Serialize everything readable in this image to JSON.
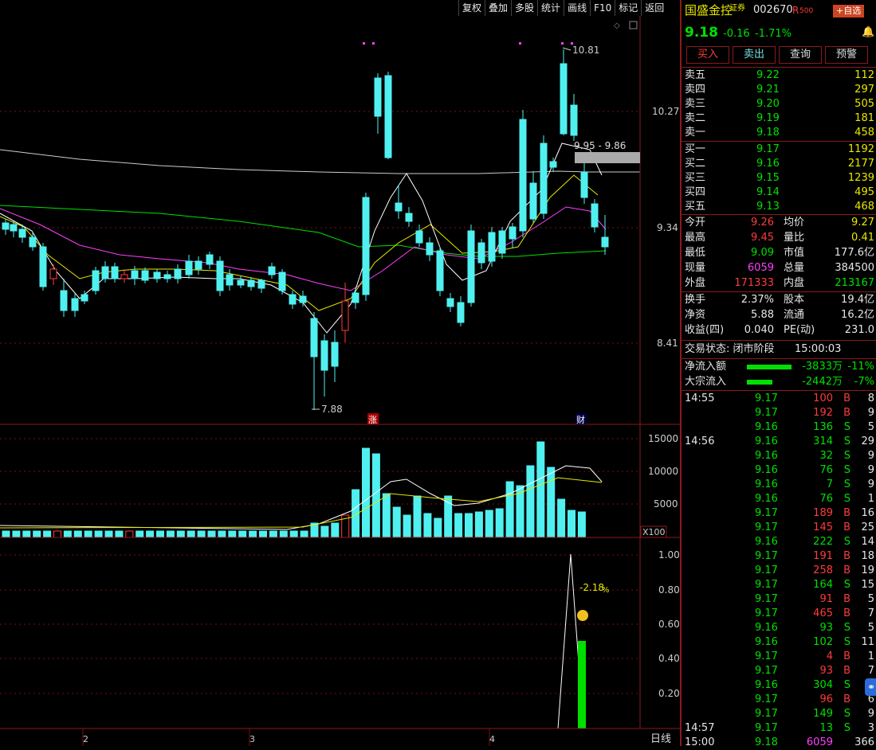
{
  "toolbar": [
    "复权",
    "叠加",
    "多股",
    "统计",
    "画线",
    "F10",
    "标记",
    "返回"
  ],
  "chart": {
    "price_ticks": [
      "10.27",
      "9.34",
      "8.41"
    ],
    "high_label": "10.81",
    "low_label": "7.88",
    "range_label": "9.95 - 9.86",
    "marker_zhang": "涨",
    "marker_cai": "财",
    "vol_ticks": [
      "15000",
      "10000",
      "5000"
    ],
    "vol_unit": "X100",
    "ind_ticks": [
      "1.00",
      "0.80",
      "0.60",
      "0.40",
      "0.20"
    ],
    "ind_label": "-2.18",
    "ind_pct": "%",
    "x_labels": [
      "2",
      "3",
      "4"
    ],
    "period": "日线",
    "colors": {
      "up": "#ff3b3b",
      "down": "#50f0f0",
      "ma5": "#ffffff",
      "ma10": "#e8e800",
      "ma20": "#ff40ff",
      "ma60": "#00e000",
      "ma250": "#cccccc"
    }
  },
  "stock": {
    "name": "国盛金控",
    "badge": "证券",
    "code": "002670",
    "tag": "R",
    "tag_num": "500",
    "add_btn": "+自选",
    "price": "9.18",
    "change": "-0.16",
    "change_pct": "-1.71%",
    "buttons": [
      "买入",
      "卖出",
      "查询",
      "预警"
    ]
  },
  "sell": [
    {
      "label": "卖五",
      "price": "9.22",
      "vol": "112"
    },
    {
      "label": "卖四",
      "price": "9.21",
      "vol": "297"
    },
    {
      "label": "卖三",
      "price": "9.20",
      "vol": "505"
    },
    {
      "label": "卖二",
      "price": "9.19",
      "vol": "181"
    },
    {
      "label": "卖一",
      "price": "9.18",
      "vol": "458"
    }
  ],
  "buy": [
    {
      "label": "买一",
      "price": "9.17",
      "vol": "1192"
    },
    {
      "label": "买二",
      "price": "9.16",
      "vol": "2177"
    },
    {
      "label": "买三",
      "price": "9.15",
      "vol": "1239"
    },
    {
      "label": "买四",
      "price": "9.14",
      "vol": "495"
    },
    {
      "label": "买五",
      "price": "9.13",
      "vol": "468"
    }
  ],
  "stats": [
    {
      "l1": "今开",
      "v1": "9.26",
      "l2": "均价",
      "v2": "9.27"
    },
    {
      "l1": "最高",
      "v1": "9.45",
      "l2": "量比",
      "v2": "0.41"
    },
    {
      "l1": "最低",
      "v1": "9.09",
      "l2": "市值",
      "v2": "177.6亿"
    },
    {
      "l1": "现量",
      "v1": "6059",
      "l2": "总量",
      "v2": "384500"
    },
    {
      "l1": "外盘",
      "v1": "171333",
      "l2": "内盘",
      "v2": "213167"
    }
  ],
  "stats2": [
    {
      "l1": "换手",
      "v1": "2.37%",
      "l2": "股本",
      "v2": "19.4亿"
    },
    {
      "l1": "净资",
      "v1": "5.88",
      "l2": "流通",
      "v2": "16.2亿"
    },
    {
      "l1": "收益(四)",
      "v1": "0.040",
      "l2": "PE(动)",
      "v2": "231.0"
    }
  ],
  "trade_status": "交易状态: 闭市阶段",
  "trade_time": "15:00:03",
  "flows": [
    {
      "label": "净流入额",
      "value": "-3833万",
      "pct": "-11%",
      "bar": 0.7
    },
    {
      "label": "大宗流入",
      "value": "-2442万",
      "pct": "-7%",
      "bar": 0.4
    }
  ],
  "ticks": [
    {
      "time": "14:55",
      "price": "9.17",
      "vol": "100",
      "side": "B",
      "n": "8"
    },
    {
      "time": "",
      "price": "9.17",
      "vol": "192",
      "side": "B",
      "n": "9"
    },
    {
      "time": "",
      "price": "9.16",
      "vol": "136",
      "side": "S",
      "n": "5"
    },
    {
      "time": "14:56",
      "price": "9.16",
      "vol": "314",
      "side": "S",
      "n": "29"
    },
    {
      "time": "",
      "price": "9.16",
      "vol": "32",
      "side": "S",
      "n": "9"
    },
    {
      "time": "",
      "price": "9.16",
      "vol": "76",
      "side": "S",
      "n": "9"
    },
    {
      "time": "",
      "price": "9.16",
      "vol": "7",
      "side": "S",
      "n": "9"
    },
    {
      "time": "",
      "price": "9.16",
      "vol": "76",
      "side": "S",
      "n": "1"
    },
    {
      "time": "",
      "price": "9.17",
      "vol": "189",
      "side": "B",
      "n": "16"
    },
    {
      "time": "",
      "price": "9.17",
      "vol": "145",
      "side": "B",
      "n": "25"
    },
    {
      "time": "",
      "price": "9.16",
      "vol": "222",
      "side": "S",
      "n": "14"
    },
    {
      "time": "",
      "price": "9.17",
      "vol": "191",
      "side": "B",
      "n": "18"
    },
    {
      "time": "",
      "price": "9.17",
      "vol": "258",
      "side": "B",
      "n": "19"
    },
    {
      "time": "",
      "price": "9.17",
      "vol": "164",
      "side": "S",
      "n": "15"
    },
    {
      "time": "",
      "price": "9.17",
      "vol": "91",
      "side": "B",
      "n": "5"
    },
    {
      "time": "",
      "price": "9.17",
      "vol": "465",
      "side": "B",
      "n": "7"
    },
    {
      "time": "",
      "price": "9.16",
      "vol": "93",
      "side": "S",
      "n": "5"
    },
    {
      "time": "",
      "price": "9.16",
      "vol": "102",
      "side": "S",
      "n": "11"
    },
    {
      "time": "",
      "price": "9.17",
      "vol": "4",
      "side": "B",
      "n": "1"
    },
    {
      "time": "",
      "price": "9.17",
      "vol": "93",
      "side": "B",
      "n": "7"
    },
    {
      "time": "",
      "price": "9.16",
      "vol": "304",
      "side": "S",
      "n": "9"
    },
    {
      "time": "",
      "price": "9.17",
      "vol": "96",
      "side": "B",
      "n": "6"
    },
    {
      "time": "",
      "price": "9.17",
      "vol": "149",
      "side": "S",
      "n": "9"
    },
    {
      "time": "14:57",
      "price": "9.17",
      "vol": "13",
      "side": "S",
      "n": "3"
    },
    {
      "time": "15:00",
      "price": "9.18",
      "vol": "6059",
      "side": "",
      "n": "366"
    }
  ]
}
